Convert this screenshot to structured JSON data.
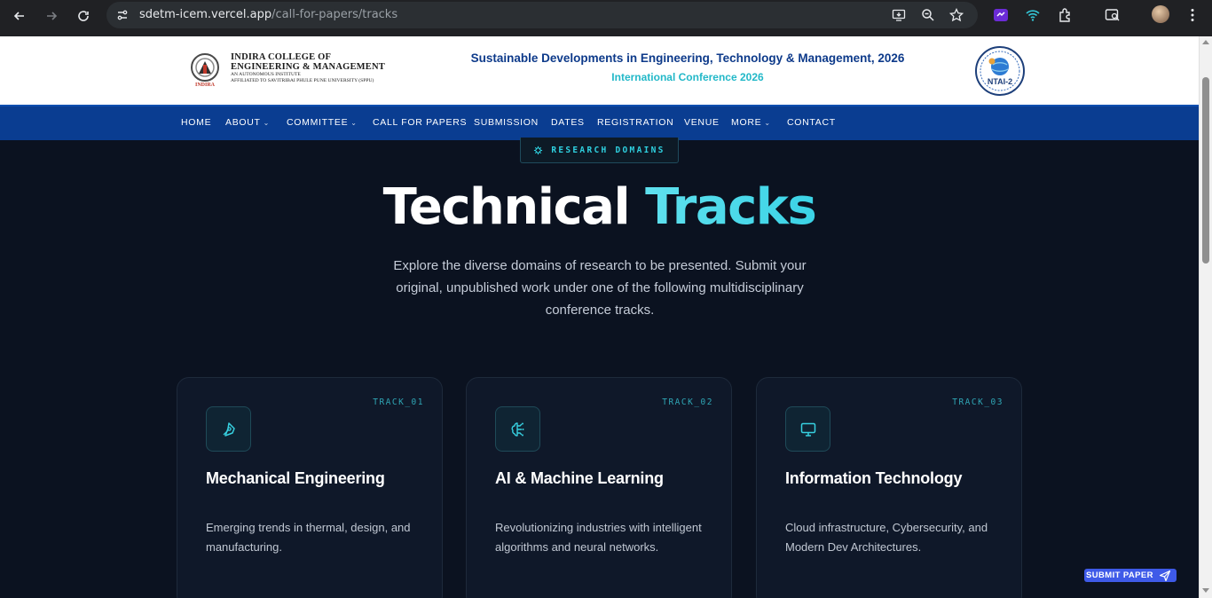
{
  "browser": {
    "url_host": "sdetm-icem.vercel.app",
    "url_path": "/call-for-papers/tracks"
  },
  "header": {
    "college_line1": "INDIRA COLLEGE OF",
    "college_line2": "ENGINEERING & MANAGEMENT",
    "college_line3": "AN AUTONOMOUS INSTITUTE",
    "college_line4": "AFFILIATED TO SAVITRIBAI PHULE PUNE UNIVERSITY (SPPU)",
    "logo_caption": "INDIRA",
    "conference_title": "Sustainable Developments in Engineering, Technology & Management, 2026",
    "conference_subtitle": "International Conference 2026",
    "ntai_label": "NTAI-2"
  },
  "nav": {
    "items": [
      {
        "label": "HOME"
      },
      {
        "label": "ABOUT"
      },
      {
        "label": "COMMITTEE"
      },
      {
        "label": "CALL FOR PAPERS"
      },
      {
        "label": "SUBMISSION"
      },
      {
        "label": "DATES"
      },
      {
        "label": "REGISTRATION"
      },
      {
        "label": "VENUE"
      },
      {
        "label": "MORE"
      },
      {
        "label": "CONTACT"
      }
    ]
  },
  "hero": {
    "badge": "RESEARCH DOMAINS",
    "title_main": "Technical",
    "title_accent": "Tracks",
    "description": "Explore the diverse domains of research to be presented. Submit your original, unpublished work under one of the following multidisciplinary conference tracks."
  },
  "tracks": [
    {
      "id": "TRACK_01",
      "title": "Mechanical Engineering",
      "description": "Emerging trends in thermal, design, and manufacturing.",
      "icon": "pen-tool-icon"
    },
    {
      "id": "TRACK_02",
      "title": "AI & Machine Learning",
      "description": "Revolutionizing industries with intelligent algorithms and neural networks.",
      "icon": "brain-circuit-icon"
    },
    {
      "id": "TRACK_03",
      "title": "Information Technology",
      "description": "Cloud infrastructure, Cybersecurity, and Modern Dev Architectures.",
      "icon": "monitor-icon"
    }
  ],
  "floating": {
    "submit_label": "SUBMIT PAPER"
  },
  "colors": {
    "accent": "#3bd3e6",
    "nav_bg": "#0a3d91",
    "page_bg": "#0b1220",
    "submit_bg": "#3e5ae8"
  }
}
